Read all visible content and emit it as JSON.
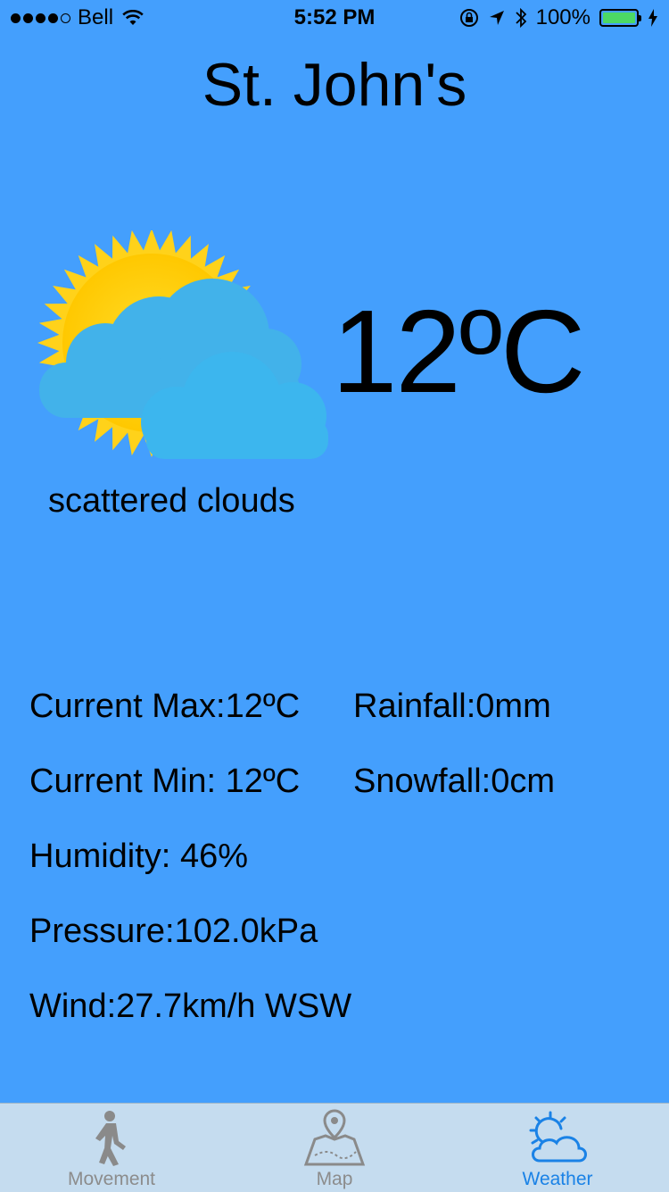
{
  "status_bar": {
    "carrier": "Bell",
    "time": "5:52 PM",
    "battery": "100%",
    "battery_level": 1.0,
    "signal_bars": 4,
    "signal_max": 5
  },
  "city": "St. John's",
  "current": {
    "temperature": "12ºC",
    "description": "scattered clouds",
    "icon": "sun-behind-clouds-icon"
  },
  "stats": {
    "max_label": "Current Max:",
    "max_value": "12ºC",
    "min_label": "Current Min:",
    "min_value": "12ºC",
    "humidity_label": "Humidity:",
    "humidity_value": "46%",
    "pressure_label": "Pressure:",
    "pressure_value": "102.0kPa",
    "wind_label": "Wind:",
    "wind_value": "27.7km/h WSW",
    "rainfall_label": "Rainfall:",
    "rainfall_value": "0mm",
    "snowfall_label": "Snowfall:",
    "snowfall_value": "0cm"
  },
  "tabs": [
    {
      "label": "Movement",
      "icon": "walking-person-icon",
      "active": false
    },
    {
      "label": "Map",
      "icon": "map-pin-icon",
      "active": false
    },
    {
      "label": "Weather",
      "icon": "weather-icon",
      "active": true
    }
  ],
  "colors": {
    "background": "#449ffd",
    "tab_bar": "#c5dcef",
    "tab_active": "#1a82e6",
    "tab_inactive": "#8c8c8c",
    "sun": "#ffd21a",
    "cloud": "#3cb4ec"
  }
}
